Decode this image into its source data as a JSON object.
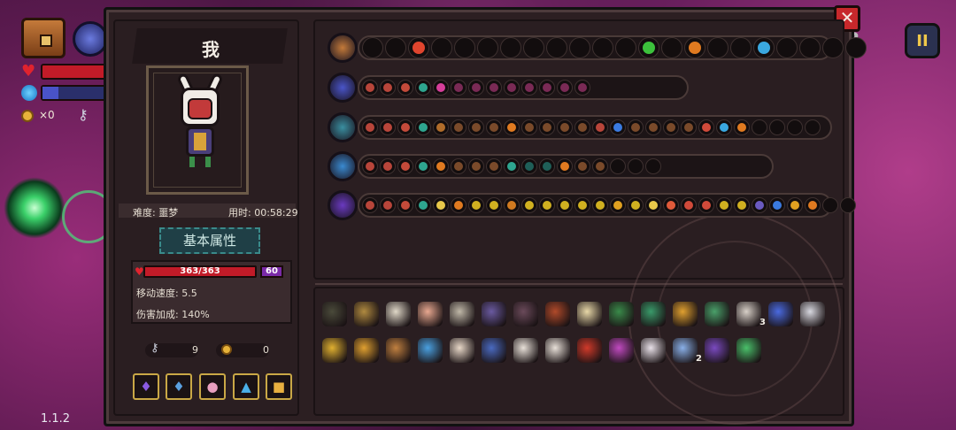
{
  "hud": {
    "coin_count": "×0",
    "version": "1.1.2",
    "pause_label": "II",
    "help_label": "?"
  },
  "close_label": "✕",
  "character": {
    "name": "我",
    "difficulty": "难度: 噩梦",
    "time_used": "用时: 00:58:29",
    "tab_label": "基本属性",
    "hp": "363/363",
    "shield": "60",
    "move_speed": "移动速度: 5.5",
    "damage_bonus": "伤害加成: 140%",
    "keys": "9",
    "coins": "0"
  },
  "potions": [
    "purple-potion",
    "blue-crystal",
    "pink-flask",
    "blue-flask",
    "golden-bottle"
  ],
  "slot_rows": [
    {
      "icon": "chest-icon",
      "icon_color": "#c47a3a",
      "count": 22,
      "filled": {
        "2": "#e0452e",
        "12": "#3cc13c",
        "14": "#e07a20",
        "17": "#3aa8e0"
      }
    },
    {
      "icon": "spiral-orb-icon",
      "icon_color": "#4a55c9",
      "count": 13,
      "filled": {
        "0": "#b8453a",
        "1": "#b8453a",
        "2": "#c34a3a",
        "3": "#2ea58f",
        "4": "#d63e9a",
        "5": "#7a2a55",
        "6": "#7a2a55",
        "7": "#7a2a55",
        "8": "#7a2a55",
        "9": "#7a2a55",
        "10": "#7a2a55",
        "11": "#7a2a55",
        "12": "#7a2a55"
      }
    },
    {
      "icon": "staff-icon",
      "icon_color": "#3a8fa0",
      "count": 26,
      "filled": {
        "0": "#b8453a",
        "1": "#b8453a",
        "2": "#c34a3a",
        "3": "#2ea58f",
        "4": "#b06c2a",
        "5": "#7a4a2a",
        "6": "#7a4a2a",
        "7": "#7a4a2a",
        "8": "#e07a20",
        "9": "#7a4a2a",
        "10": "#7a4a2a",
        "11": "#7a4a2a",
        "12": "#7a4a2a",
        "13": "#b8453a",
        "14": "#3a7ae0",
        "15": "#7a4a2a",
        "16": "#7a4a2a",
        "17": "#7a4a2a",
        "18": "#7a4a2a",
        "19": "#d04a3a",
        "20": "#3aa8e0",
        "21": "#e07a20"
      }
    },
    {
      "icon": "blue-crystal-icon",
      "icon_color": "#3a8ad0",
      "count": 17,
      "filled": {
        "0": "#b8453a",
        "1": "#b8453a",
        "2": "#c34a3a",
        "3": "#2ea58f",
        "4": "#e07a20",
        "5": "#7a4a2a",
        "6": "#7a4a2a",
        "7": "#7a4a2a",
        "8": "#2ea58f",
        "9": "#1f5f58",
        "10": "#1f5f58",
        "11": "#e07a20",
        "12": "#7a4a2a",
        "13": "#7a4a2a"
      }
    },
    {
      "icon": "wand-icon",
      "icon_color": "#6a3ac0",
      "count": 28,
      "filled": {
        "0": "#b8453a",
        "1": "#b8453a",
        "2": "#c34a3a",
        "3": "#2ea58f",
        "4": "#e8c84a",
        "5": "#e07a20",
        "6": "#d0b020",
        "7": "#d0b020",
        "8": "#d07a20",
        "9": "#d0b020",
        "10": "#d0b020",
        "11": "#d0b020",
        "12": "#d0b020",
        "13": "#d0b020",
        "14": "#e0a020",
        "15": "#d0b020",
        "16": "#e8c84a",
        "17": "#e05a3a",
        "18": "#d04a3a",
        "19": "#d04a3a",
        "20": "#d0b020",
        "21": "#d0b020",
        "22": "#6a5ac0",
        "23": "#3a7ae0",
        "24": "#e0a020",
        "25": "#e07a20"
      }
    }
  ],
  "items": [
    {
      "name": "shadow-mask-icon",
      "color": "#4a4a3a"
    },
    {
      "name": "golden-lantern-icon",
      "color": "#b08a40"
    },
    {
      "name": "fang-necklace-icon",
      "color": "#e0d8c8"
    },
    {
      "name": "brain-icon",
      "color": "#e8a890"
    },
    {
      "name": "goggles-icon",
      "color": "#c0b8a8"
    },
    {
      "name": "rune-tablet-icon",
      "color": "#6a5aa0"
    },
    {
      "name": "dark-cloak-icon",
      "color": "#6a4a5a"
    },
    {
      "name": "spellbook-icon",
      "color": "#b04a2a"
    },
    {
      "name": "bread-icon",
      "color": "#e8d8a8"
    },
    {
      "name": "green-boot-icon",
      "color": "#3a8a4a"
    },
    {
      "name": "green-belt-icon",
      "color": "#3a9a6a"
    },
    {
      "name": "scroll-icon",
      "color": "#e0a030"
    },
    {
      "name": "emerald-tile-icon",
      "color": "#4aa06a"
    },
    {
      "name": "ribcage-icon",
      "color": "#d8d0c8",
      "count": "3"
    },
    {
      "name": "blue-vial-icon",
      "color": "#4a6ae0"
    },
    {
      "name": "white-feather-icon",
      "color": "#d8d8e0"
    },
    {
      "name": "golden-bell-icon",
      "color": "#e0b030"
    },
    {
      "name": "honey-jar-icon",
      "color": "#e0a030"
    },
    {
      "name": "pickaxe-icon",
      "color": "#c08040"
    },
    {
      "name": "magnifier-icon",
      "color": "#4aa0e0"
    },
    {
      "name": "quill-icon",
      "color": "#e8d8c8"
    },
    {
      "name": "blue-ghost-icon",
      "color": "#4a6ac0"
    },
    {
      "name": "skull-crest-icon",
      "color": "#e8e0d8"
    },
    {
      "name": "bone-blade-icon",
      "color": "#e8e0d8"
    },
    {
      "name": "red-demon-icon",
      "color": "#d03a2a"
    },
    {
      "name": "rainbow-shard-icon",
      "color": "#c04ac0"
    },
    {
      "name": "wing-icon",
      "color": "#e8e0e8"
    },
    {
      "name": "ice-crystal-icon",
      "color": "#8ab0e8",
      "count": "2"
    },
    {
      "name": "violet-robe-icon",
      "color": "#7a4ac0"
    },
    {
      "name": "leaf-icon",
      "color": "#4ac06a"
    }
  ]
}
